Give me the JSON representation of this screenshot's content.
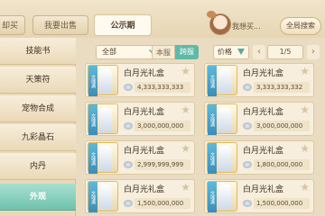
{
  "header": {
    "tabs": [
      "我要购买",
      "我要出售",
      "公示期"
    ],
    "tab_buy_visible": "却买",
    "tab_sell": "我要出售",
    "tab_notice": "公示期",
    "want_buy": "我想买...",
    "global_search": "全局搜索"
  },
  "sidebar": {
    "items": [
      {
        "label": "技能书"
      },
      {
        "label": "天策符"
      },
      {
        "label": "宠物合成"
      },
      {
        "label": "九彩晶石"
      },
      {
        "label": "内丹"
      },
      {
        "label": "外观"
      }
    ],
    "active_index": 5
  },
  "filters": {
    "category": "全部",
    "server_local": "本服",
    "server_cross": "跨服",
    "sort": "价格",
    "page": "1/5"
  },
  "items": [
    {
      "name": "白月光礼盒",
      "price": "4,333,333,333",
      "tag": "文魂满"
    },
    {
      "name": "白月光礼盒",
      "price": "3,333,333,332",
      "tag": "文魂满"
    },
    {
      "name": "白月光礼盒",
      "price": "3,000,000,000",
      "tag": "文魂满"
    },
    {
      "name": "白月光礼盒",
      "price": "3,000,000,000",
      "tag": "文魂满"
    },
    {
      "name": "白月光礼盒",
      "price": "2,999,999,999",
      "tag": "文魂满"
    },
    {
      "name": "白月光礼盒",
      "price": "1,800,000,000",
      "tag": "文魂满"
    },
    {
      "name": "白月光礼盒",
      "price": "1,500,000,000",
      "tag": "文魂满"
    },
    {
      "name": "白月光礼盒",
      "price": "1,500,000,000",
      "tag": "文魂满"
    }
  ],
  "colors": {
    "accent": "#5fb9a8",
    "background": "#e9dcc1"
  }
}
